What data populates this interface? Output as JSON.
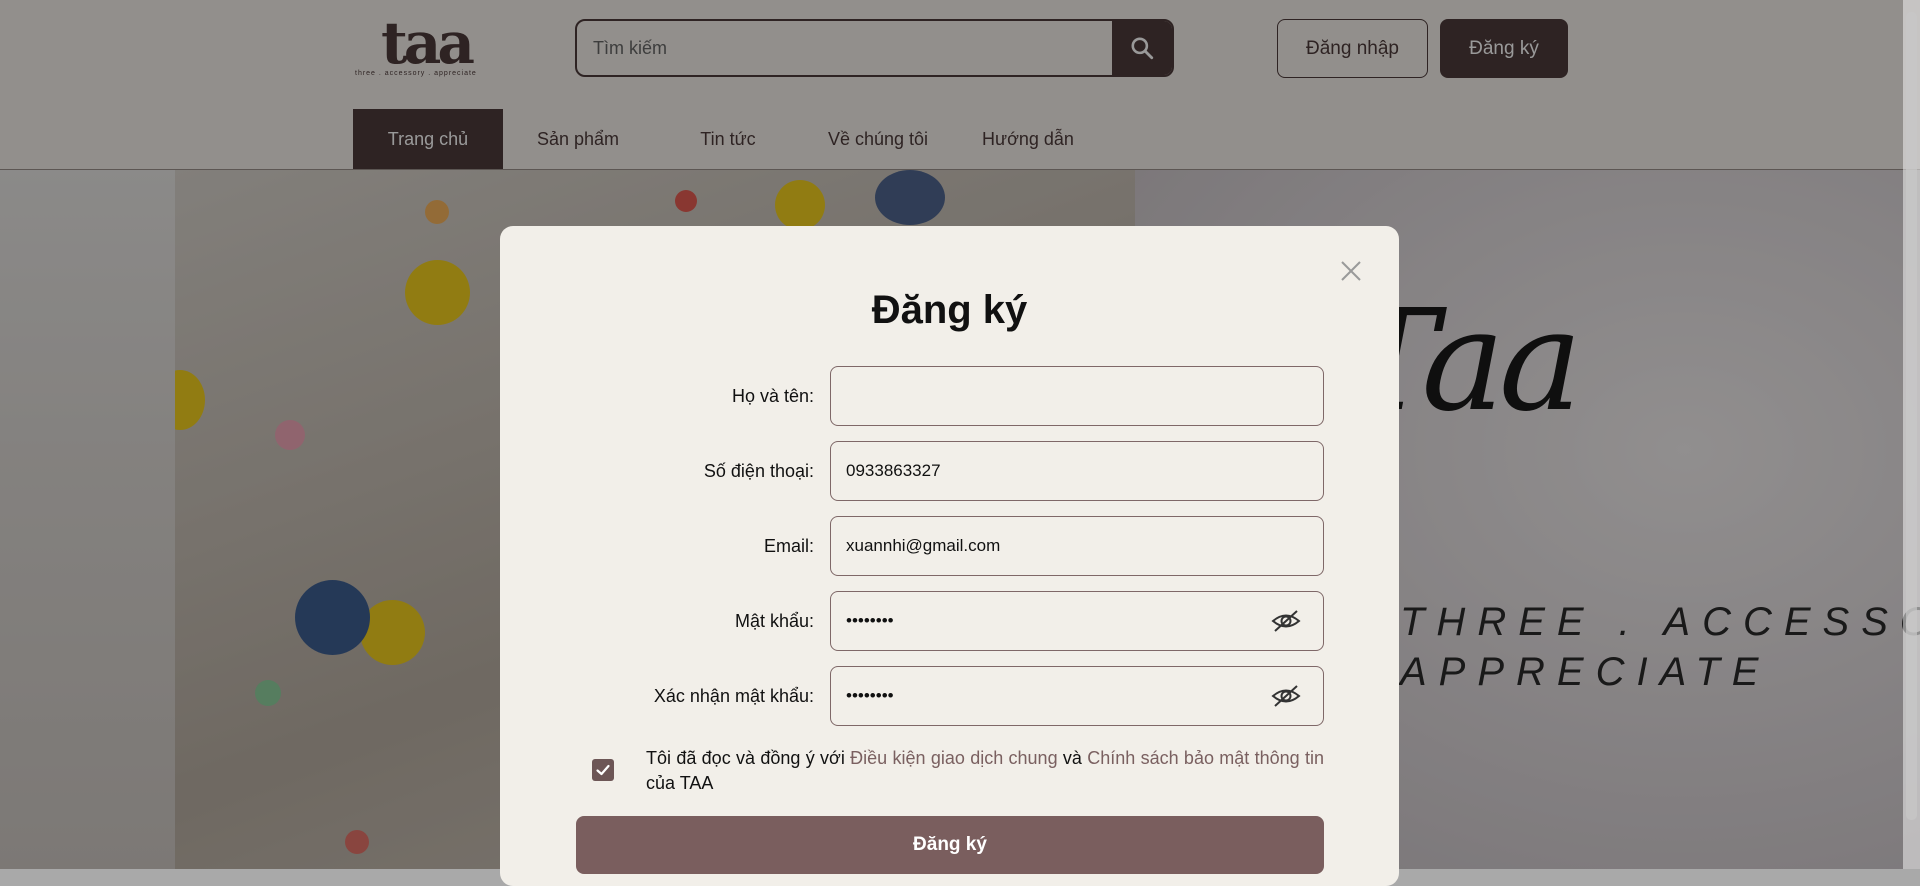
{
  "header": {
    "logo_mark": "taa",
    "logo_tagline": "three . accessory . appreciate",
    "search_placeholder": "Tìm kiếm",
    "login_label": "Đăng nhập",
    "register_label": "Đăng ký"
  },
  "nav": {
    "items": [
      {
        "label": "Trang chủ",
        "active": true
      },
      {
        "label": "Sản phẩm",
        "active": false
      },
      {
        "label": "Tin tức",
        "active": false
      },
      {
        "label": "Về chúng tôi",
        "active": false
      },
      {
        "label": "Hướng dẫn",
        "active": false
      }
    ]
  },
  "hero": {
    "brand_script": "Taa",
    "tagline_line1": "THREE . ACCESSO",
    "tagline_line2": "APPRECIATE"
  },
  "modal": {
    "title": "Đăng ký",
    "fields": {
      "fullname": {
        "label": "Họ và tên:",
        "value": ""
      },
      "phone": {
        "label": "Số điện thoại:",
        "value": "0933863327"
      },
      "email": {
        "label": "Email:",
        "value": "xuannhi@gmail.com"
      },
      "password": {
        "label": "Mật khẩu:",
        "value": "password"
      },
      "confirm_password": {
        "label": "Xác nhận mật khẩu:",
        "value": "password"
      }
    },
    "agree": {
      "checked": true,
      "prefix": "Tôi đã đọc và đồng ý với ",
      "terms_link": "Điều kiện giao dịch chung",
      "and": " và ",
      "privacy_link": "Chính sách bảo mật thông tin",
      "suffix": " của TAA"
    },
    "submit_label": "Đăng ký"
  },
  "icons": {
    "search": "search-icon",
    "close": "close-icon",
    "eye_off": "eye-off-icon",
    "check": "check-icon"
  },
  "colors": {
    "brand": "#4e3b3b",
    "submit": "#7a5e5e",
    "link": "#7a6060",
    "modal_bg": "#f2efe9"
  }
}
